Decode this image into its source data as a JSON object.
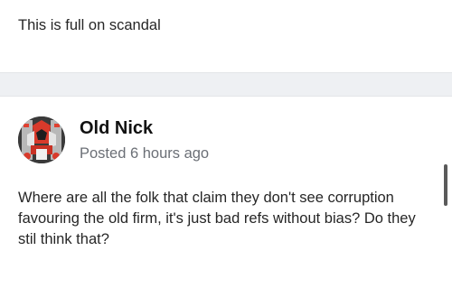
{
  "previous_post": {
    "text": "This is full on scandal"
  },
  "post": {
    "author": "Old Nick",
    "meta": "Posted 6 hours ago",
    "avatar_icon": "avatar-icon",
    "content": "Where are all the folk that claim they don't see corruption favouring the old firm, it's just bad refs without bias? Do they stil think that?"
  },
  "colors": {
    "separator": "#eef0f3",
    "meta_text": "#6b6f76",
    "scrollbar": "#5a5a5a"
  }
}
